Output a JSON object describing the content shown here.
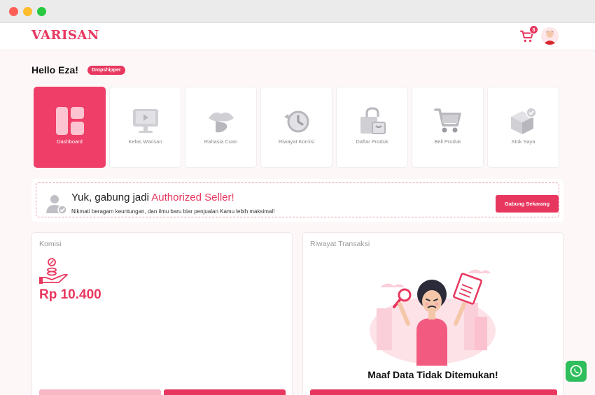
{
  "window": {
    "controls": [
      "close",
      "minimize",
      "maximize"
    ]
  },
  "header": {
    "logo": "VARISAN",
    "cart_count": "8",
    "colors": {
      "brand": "#e8375f"
    }
  },
  "greeting": {
    "text": "Hello Eza!",
    "role": "Dropshipper"
  },
  "menu": [
    {
      "label": "Dashboard",
      "icon": "dashboard-icon",
      "active": true
    },
    {
      "label": "Kelas Warisan",
      "icon": "monitor-icon"
    },
    {
      "label": "Rahasia Cuan",
      "icon": "lips-icon"
    },
    {
      "label": "Riwayat Komisi",
      "icon": "history-icon"
    },
    {
      "label": "Daftar Produk",
      "icon": "shopping-bag-icon"
    },
    {
      "label": "Beli Produk",
      "icon": "cart-icon"
    },
    {
      "label": "Stok Saya",
      "icon": "box-check-icon"
    }
  ],
  "banner": {
    "title_prefix": "Yuk, gabung jadi ",
    "title_highlight": "Authorized Seller!",
    "subtitle": "Nikmati beragam keuntungan, dan ilmu baru biar penjualan Kamu lebih maksimal!",
    "button": "Gabung Sekarang"
  },
  "komisi": {
    "title": "Komisi",
    "value": "Rp 10.400"
  },
  "transaksi": {
    "title": "Riwayat Transaksi",
    "empty_message": "Maaf Data Tidak Ditemukan!"
  }
}
